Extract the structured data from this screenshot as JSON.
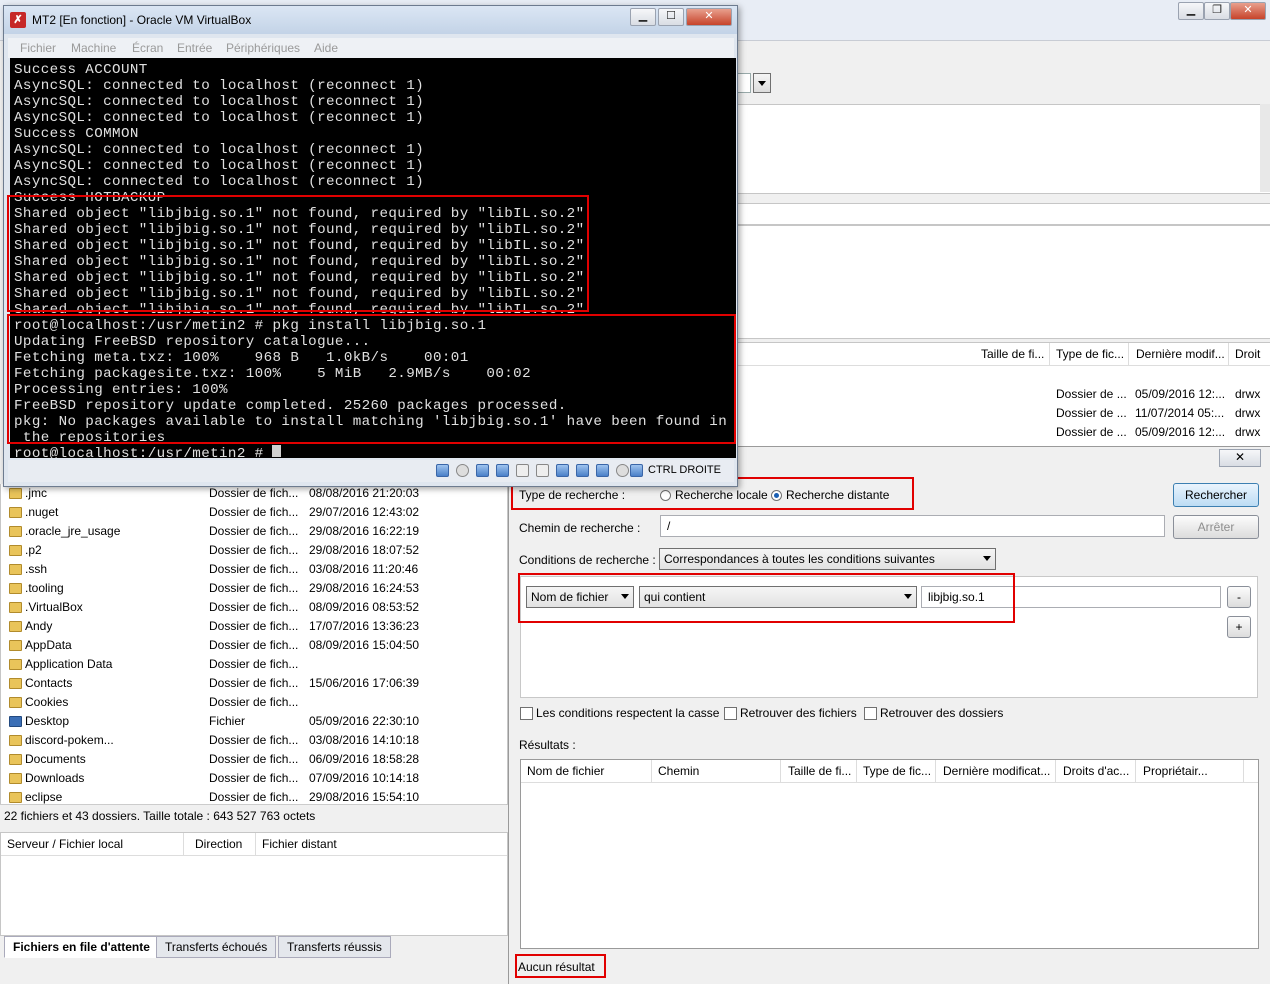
{
  "filezilla": {
    "remote_columns": [
      "Taille de fi...",
      "Type de fic...",
      "Dernière modif...",
      "Droit"
    ],
    "remote_rows": [
      {
        "type": "Dossier de ...",
        "date": "05/09/2016 12:...",
        "perm": "drwx"
      },
      {
        "type": "Dossier de ...",
        "date": "11/07/2014 05:...",
        "perm": "drwx"
      },
      {
        "type": "Dossier de ...",
        "date": "05/09/2016 12:...",
        "perm": "drwx"
      }
    ],
    "local_rows": [
      {
        "name": ".jmc",
        "type": "Dossier de fich...",
        "date": "08/08/2016 21:20:03"
      },
      {
        "name": ".nuget",
        "type": "Dossier de fich...",
        "date": "29/07/2016 12:43:02"
      },
      {
        "name": ".oracle_jre_usage",
        "type": "Dossier de fich...",
        "date": "29/08/2016 16:22:19"
      },
      {
        "name": ".p2",
        "type": "Dossier de fich...",
        "date": "29/08/2016 18:07:52"
      },
      {
        "name": ".ssh",
        "type": "Dossier de fich...",
        "date": "03/08/2016 11:20:46"
      },
      {
        "name": ".tooling",
        "type": "Dossier de fich...",
        "date": "29/08/2016 16:24:53"
      },
      {
        "name": ".VirtualBox",
        "type": "Dossier de fich...",
        "date": "08/09/2016 08:53:52"
      },
      {
        "name": "Andy",
        "type": "Dossier de fich...",
        "date": "17/07/2016 13:36:23"
      },
      {
        "name": "AppData",
        "type": "Dossier de fich...",
        "date": "08/09/2016 15:04:50"
      },
      {
        "name": "Application Data",
        "type": "Dossier de fich...",
        "date": ""
      },
      {
        "name": "Contacts",
        "type": "Dossier de fich...",
        "date": "15/06/2016 17:06:39"
      },
      {
        "name": "Cookies",
        "type": "Dossier de fich...",
        "date": ""
      },
      {
        "name": "Desktop",
        "type": "Fichier",
        "date": "05/09/2016 22:30:10"
      },
      {
        "name": "discord-pokem...",
        "type": "Dossier de fich...",
        "date": "03/08/2016 14:10:18"
      },
      {
        "name": "Documents",
        "type": "Dossier de fich...",
        "date": "06/09/2016 18:58:28"
      },
      {
        "name": "Downloads",
        "type": "Dossier de fich...",
        "date": "07/09/2016 10:14:18"
      },
      {
        "name": "eclipse",
        "type": "Dossier de fich...",
        "date": "29/08/2016 15:54:10"
      }
    ],
    "local_status": "22 fichiers et 43 dossiers. Taille totale : 643 527 763 octets",
    "queue_columns": [
      "Serveur / Fichier local",
      "Direction",
      "Fichier distant"
    ],
    "queue_tabs": [
      "Fichiers en file d'attente",
      "Transferts échoués",
      "Transferts réussis"
    ]
  },
  "search_dialog": {
    "close_glyph": "✕",
    "type_label": "Type de recherche :",
    "radio_local": "Recherche locale",
    "radio_remote": "Recherche distante",
    "search_button": "Rechercher",
    "path_label": "Chemin de recherche :",
    "path_value": "/",
    "stop_button": "Arrêter",
    "conditions_label": "Conditions de recherche :",
    "conditions_value": "Correspondances à toutes les conditions suivantes",
    "field_select": "Nom de fichier",
    "operator_select": "qui contient",
    "condition_value": "libjbig.so.1",
    "minus_button": "-",
    "plus_button": "+",
    "check_case": "Les conditions respectent la casse",
    "check_files": "Retrouver des fichiers",
    "check_dirs": "Retrouver des dossiers",
    "results_label": "Résultats :",
    "results_columns": [
      "Nom de fichier",
      "Chemin",
      "Taille de fi...",
      "Type de fic...",
      "Dernière modificat...",
      "Droits d'ac...",
      "Propriétair..."
    ],
    "status": "Aucun résultat"
  },
  "vbox": {
    "title": "MT2 [En fonction] - Oracle VM VirtualBox",
    "menu": [
      "Fichier",
      "Machine",
      "Écran",
      "Entrée",
      "Périphériques",
      "Aide"
    ],
    "terminal_lines": [
      "Success ACCOUNT",
      "AsyncSQL: connected to localhost (reconnect 1)",
      "AsyncSQL: connected to localhost (reconnect 1)",
      "AsyncSQL: connected to localhost (reconnect 1)",
      "Success COMMON",
      "AsyncSQL: connected to localhost (reconnect 1)",
      "AsyncSQL: connected to localhost (reconnect 1)",
      "AsyncSQL: connected to localhost (reconnect 1)",
      "Success HOTBACKUP",
      "Shared object \"libjbig.so.1\" not found, required by \"libIL.so.2\"",
      "Shared object \"libjbig.so.1\" not found, required by \"libIL.so.2\"",
      "Shared object \"libjbig.so.1\" not found, required by \"libIL.so.2\"",
      "Shared object \"libjbig.so.1\" not found, required by \"libIL.so.2\"",
      "Shared object \"libjbig.so.1\" not found, required by \"libIL.so.2\"",
      "Shared object \"libjbig.so.1\" not found, required by \"libIL.so.2\"",
      "Shared object \"libjbig.so.1\" not found, required by \"libIL.so.2\"",
      "root@localhost:/usr/metin2 # pkg install libjbig.so.1",
      "Updating FreeBSD repository catalogue...",
      "Fetching meta.txz: 100%    968 B   1.0kB/s    00:01",
      "Fetching packagesite.txz: 100%    5 MiB   2.9MB/s    00:02",
      "Processing entries: 100%",
      "FreeBSD repository update completed. 25260 packages processed.",
      "pkg: No packages available to install matching 'libjbig.so.1' have been found in",
      " the repositories",
      "root@localhost:/usr/metin2 # "
    ],
    "status_host_key": "CTRL DROITE"
  }
}
